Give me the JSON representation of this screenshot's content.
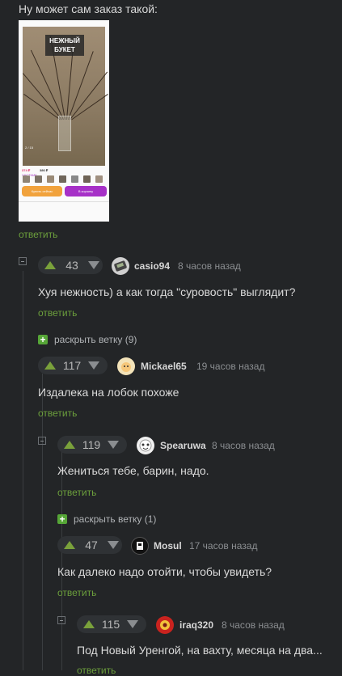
{
  "post": {
    "caption": "Ну может сам заказ такой:",
    "reply_label": "ответить",
    "screenshot": {
      "title_lines": [
        "НЕЖНЫЙ",
        "БУКЕТ"
      ],
      "price_1": "374 ₽",
      "price_2": "386 ₽",
      "buy_label": "Купить сейчас",
      "cart_label": "В корзину",
      "counter": "2 / 15",
      "badge": "ЧАСТНИК"
    }
  },
  "comments": [
    {
      "score": "43",
      "username": "casio94",
      "time": "8 часов назад",
      "text": "Хуя нежность) а как тогда \"суровость\" выглядит?",
      "reply": "ответить",
      "expand": "раскрыть ветку (9)"
    },
    {
      "score": "117",
      "username": "Mickael65",
      "time": "19 часов назад",
      "text": "Издалека на лобок похоже",
      "reply": "ответить"
    },
    {
      "score": "119",
      "username": "Spearuwa",
      "time": "8 часов назад",
      "text": "Жениться тебе, барин, надо.",
      "reply": "ответить",
      "expand": "раскрыть ветку (1)"
    },
    {
      "score": "47",
      "username": "Mosul",
      "time": "17 часов назад",
      "text": "Как далеко надо отойти, чтобы увидеть?",
      "reply": "ответить"
    },
    {
      "score": "115",
      "username": "iraq320",
      "time": "8 часов назад",
      "text": "Под Новый Уренгой, на вахту, месяца на два...",
      "reply": "ответить"
    }
  ]
}
